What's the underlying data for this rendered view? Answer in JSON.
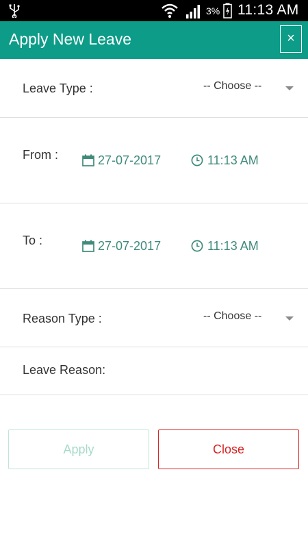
{
  "status_bar": {
    "battery": "3%",
    "time": "11:13 AM",
    "icons": [
      "usb-icon",
      "wifi-icon",
      "signal-icon",
      "battery-icon"
    ]
  },
  "header": {
    "title": "Apply New Leave",
    "close_label": "×",
    "color": "#0c9c88"
  },
  "form": {
    "leave_type": {
      "label": "Leave Type :",
      "value": "-- Choose --"
    },
    "from": {
      "label": "From :",
      "date": "27-07-2017",
      "time": "11:13 AM"
    },
    "to": {
      "label": "To :",
      "date": "27-07-2017",
      "time": "11:13 AM"
    },
    "reason_type": {
      "label": "Reason Type :",
      "value": "-- Choose --"
    },
    "leave_reason": {
      "label": "Leave Reason:"
    }
  },
  "actions": {
    "apply_label": "Apply",
    "close_label": "Close",
    "close_color": "#d62424"
  }
}
